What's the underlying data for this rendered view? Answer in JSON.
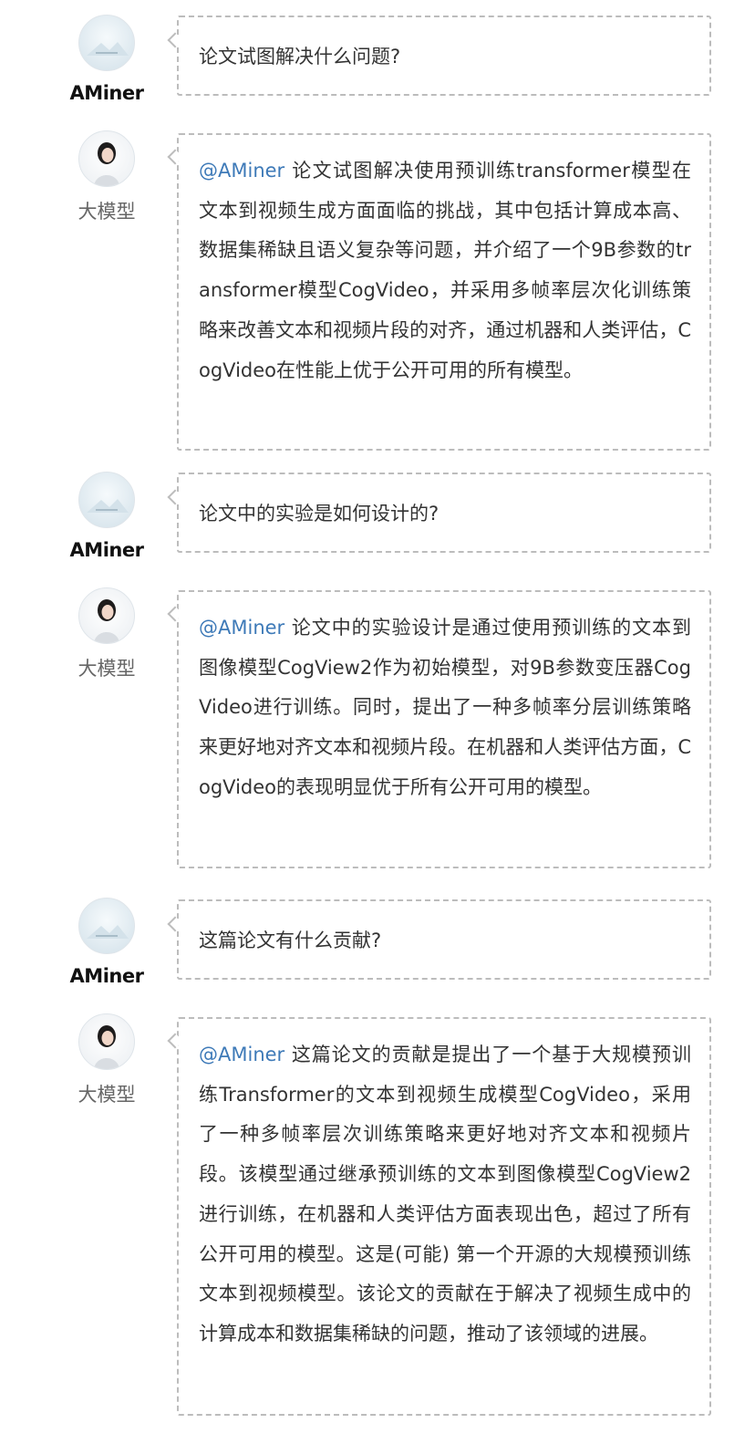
{
  "messages": [
    {
      "role": "question",
      "name": "AMiner",
      "text": "论文试图解决什么问题?"
    },
    {
      "role": "answer",
      "name": "大模型",
      "mention": "@AMiner",
      "text": " 论文试图解决使用预训练transformer模型在文本到视频生成方面面临的挑战，其中包括计算成本高、数据集稀缺且语义复杂等问题，并介绍了一个9B参数的transformer模型CogVideo，并采用多帧率层次化训练策略来改善文本和视频片段的对齐，通过机器和人类评估，CogVideo在性能上优于公开可用的所有模型。"
    },
    {
      "role": "question",
      "name": "AMiner",
      "text": "论文中的实验是如何设计的?"
    },
    {
      "role": "answer",
      "name": "大模型",
      "mention": "@AMiner",
      "text": " 论文中的实验设计是通过使用预训练的文本到图像模型CogView2作为初始模型，对9B参数变压器CogVideo进行训练。同时，提出了一种多帧率分层训练策略来更好地对齐文本和视频片段。在机器和人类评估方面，CogVideo的表现明显优于所有公开可用的模型。"
    },
    {
      "role": "question",
      "name": "AMiner",
      "text": "这篇论文有什么贡献?"
    },
    {
      "role": "answer",
      "name": "大模型",
      "mention": "@AMiner",
      "text": " 这篇论文的贡献是提出了一个基于大规模预训练Transformer的文本到视频生成模型CogVideo，采用了一种多帧率层次训练策略来更好地对齐文本和视频片段。该模型通过继承预训练的文本到图像模型CogView2进行训练，在机器和人类评估方面表现出色，超过了所有公开可用的模型。这是(可能) 第一个开源的大规模预训练文本到视频模型。该论文的贡献在于解决了视频生成中的计算成本和数据集稀缺的问题，推动了该领域的进展。"
    }
  ],
  "avatar_icons": {
    "question": "aminer-logo-icon",
    "answer": "llm-assistant-avatar-icon"
  }
}
